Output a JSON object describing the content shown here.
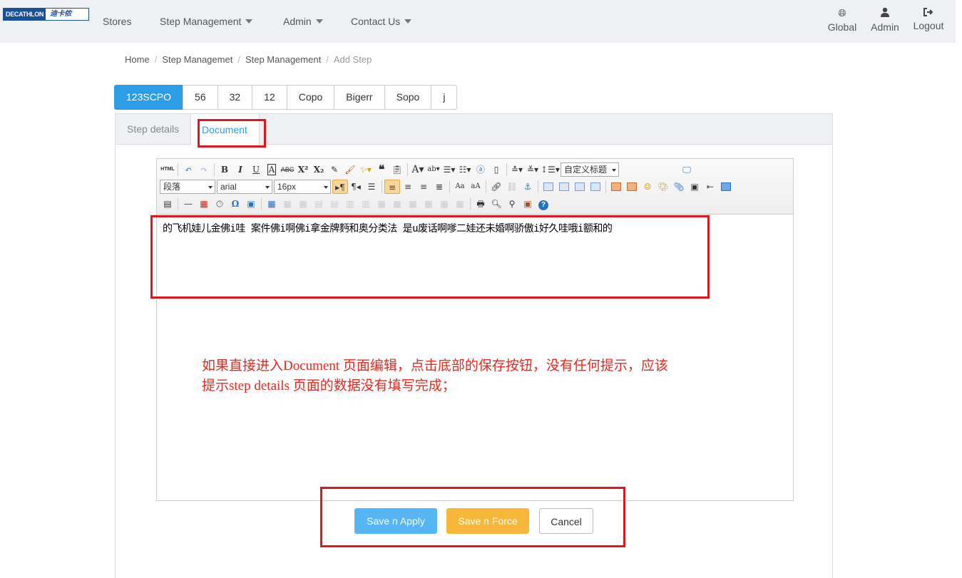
{
  "nav": {
    "logo_text": "DECATHLON",
    "logo_cn": "迪卡侬",
    "items": [
      {
        "label": "Stores"
      },
      {
        "label": "Step Management"
      },
      {
        "label": "Admin"
      },
      {
        "label": "Contact Us"
      }
    ],
    "right": [
      {
        "label": "Global",
        "icon": "globe-icon"
      },
      {
        "label": "Admin",
        "icon": "user-icon"
      },
      {
        "label": "Logout",
        "icon": "logout-icon"
      }
    ]
  },
  "breadcrumb": [
    "Home",
    "Step Managemet",
    "Step Management",
    "Add Step"
  ],
  "pills": [
    "123SCPO",
    "56",
    "32",
    "12",
    "Copo",
    "Bigerr",
    "Sopo",
    "j"
  ],
  "panel_tabs": [
    "Step details",
    "Document"
  ],
  "editor": {
    "toolbar": {
      "paragraph": "段落",
      "font": "arial",
      "size": "16px",
      "custom_title": "自定义标题"
    },
    "content": "的飞机娃儿金佛i哇 案件佛i啊佛i拿金牌麪和奥分类法 是u废话啊嗲二娃还未婚啊骄傲i好久哇哦i额和的"
  },
  "annotation": {
    "line1": "如果直接进入Document 页面编辑，点击底部的保存按钮，没有任何提示，应该",
    "line2": "提示step details 页面的数据没有填写完成；"
  },
  "buttons": {
    "apply": "Save n Apply",
    "force": "Save n Force",
    "cancel": "Cancel"
  },
  "colors": {
    "accent": "#2c9ee8",
    "apply": "#56b5f5",
    "force": "#f7b73a",
    "annotation": "#e8281e"
  }
}
